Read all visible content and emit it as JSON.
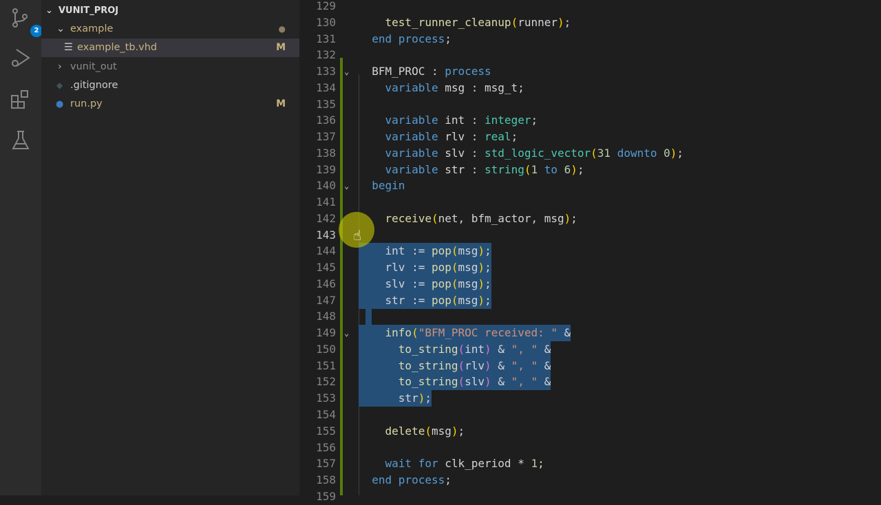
{
  "activity_bar": {
    "source_control_badge": "2",
    "items": [
      "source-control-icon",
      "run-debug-icon",
      "extensions-icon",
      "testing-icon"
    ]
  },
  "explorer": {
    "root": "VUNIT_PROJ",
    "items": [
      {
        "label": "example",
        "type": "folder-open",
        "status": "●",
        "color": "#c9b37e"
      },
      {
        "label": "example_tb.vhd",
        "type": "file",
        "status": "M",
        "color": "#c9b37e"
      },
      {
        "label": "vunit_out",
        "type": "folder-closed",
        "status": "",
        "color": "#8b8b8b"
      },
      {
        "label": ".gitignore",
        "type": "file",
        "status": "",
        "color": "#cccccc"
      },
      {
        "label": "run.py",
        "type": "python",
        "status": "M",
        "color": "#c9b37e"
      }
    ]
  },
  "editor": {
    "first_line": 129,
    "current_line": 143,
    "selection": [
      144,
      153
    ],
    "folds": [
      133,
      140,
      149
    ],
    "lines": [
      [],
      [
        [
          "    "
        ],
        [
          "test_runner_cleanup",
          "f"
        ],
        [
          "(",
          "p1"
        ],
        [
          "runner"
        ],
        [
          ")",
          "p1"
        ],
        [
          ";"
        ]
      ],
      [
        [
          "  "
        ],
        [
          "end process",
          "k"
        ],
        [
          ";"
        ]
      ],
      [],
      [
        [
          "  BFM_PROC : "
        ],
        [
          "process",
          "k"
        ]
      ],
      [
        [
          "    "
        ],
        [
          "variable",
          "k"
        ],
        [
          " msg : msg_t;"
        ]
      ],
      [],
      [
        [
          "    "
        ],
        [
          "variable",
          "k"
        ],
        [
          " int : "
        ],
        [
          "integer",
          "t"
        ],
        [
          ";"
        ]
      ],
      [
        [
          "    "
        ],
        [
          "variable",
          "k"
        ],
        [
          " rlv : "
        ],
        [
          "real",
          "t"
        ],
        [
          ";"
        ]
      ],
      [
        [
          "    "
        ],
        [
          "variable",
          "k"
        ],
        [
          " slv : "
        ],
        [
          "std_logic_vector",
          "t"
        ],
        [
          "(",
          "p1"
        ],
        [
          "31",
          "n"
        ],
        [
          " "
        ],
        [
          "downto",
          "k"
        ],
        [
          " "
        ],
        [
          "0",
          "n"
        ],
        [
          ")",
          "p1"
        ],
        [
          ";"
        ]
      ],
      [
        [
          "    "
        ],
        [
          "variable",
          "k"
        ],
        [
          " str : "
        ],
        [
          "string",
          "t"
        ],
        [
          "(",
          "p1"
        ],
        [
          "1",
          "n"
        ],
        [
          " "
        ],
        [
          "to",
          "k"
        ],
        [
          " "
        ],
        [
          "6",
          "n"
        ],
        [
          ")",
          "p1"
        ],
        [
          ";"
        ]
      ],
      [
        [
          "  "
        ],
        [
          "begin",
          "k"
        ]
      ],
      [],
      [
        [
          "    "
        ],
        [
          "receive",
          "f"
        ],
        [
          "(",
          "p1"
        ],
        [
          "net, bfm_actor, msg"
        ],
        [
          ")",
          "p1"
        ],
        [
          ";"
        ]
      ],
      [],
      [
        [
          "    int := "
        ],
        [
          "pop",
          "f"
        ],
        [
          "(",
          "p1"
        ],
        [
          "msg"
        ],
        [
          ")",
          "p1"
        ],
        [
          ";"
        ]
      ],
      [
        [
          "    rlv := "
        ],
        [
          "pop",
          "f"
        ],
        [
          "(",
          "p1"
        ],
        [
          "msg"
        ],
        [
          ")",
          "p1"
        ],
        [
          ";"
        ]
      ],
      [
        [
          "    slv := "
        ],
        [
          "pop",
          "f"
        ],
        [
          "(",
          "p1"
        ],
        [
          "msg"
        ],
        [
          ")",
          "p1"
        ],
        [
          ";"
        ]
      ],
      [
        [
          "    str := "
        ],
        [
          "pop",
          "f"
        ],
        [
          "(",
          "p1"
        ],
        [
          "msg"
        ],
        [
          ")",
          "p1"
        ],
        [
          ";"
        ]
      ],
      [
        [
          "  "
        ]
      ],
      [
        [
          "    "
        ],
        [
          "info",
          "f"
        ],
        [
          "(",
          "p1"
        ],
        [
          "\"BFM_PROC received: \"",
          "s"
        ],
        [
          " &"
        ]
      ],
      [
        [
          "      "
        ],
        [
          "to_string",
          "f"
        ],
        [
          "(",
          "p2"
        ],
        [
          "int"
        ],
        [
          ")",
          "p2"
        ],
        [
          " & "
        ],
        [
          "\", \"",
          "s"
        ],
        [
          " &"
        ]
      ],
      [
        [
          "      "
        ],
        [
          "to_string",
          "f"
        ],
        [
          "(",
          "p2"
        ],
        [
          "rlv"
        ],
        [
          ")",
          "p2"
        ],
        [
          " & "
        ],
        [
          "\", \"",
          "s"
        ],
        [
          " &"
        ]
      ],
      [
        [
          "      "
        ],
        [
          "to_string",
          "f"
        ],
        [
          "(",
          "p2"
        ],
        [
          "slv"
        ],
        [
          ")",
          "p2"
        ],
        [
          " & "
        ],
        [
          "\", \"",
          "s"
        ],
        [
          " &"
        ]
      ],
      [
        [
          "      str"
        ],
        [
          ")",
          "p1"
        ],
        [
          ";"
        ]
      ],
      [],
      [
        [
          "    "
        ],
        [
          "delete",
          "f"
        ],
        [
          "(",
          "p1"
        ],
        [
          "msg"
        ],
        [
          ")",
          "p1"
        ],
        [
          ";"
        ]
      ],
      [],
      [
        [
          "    "
        ],
        [
          "wait for",
          "k"
        ],
        [
          " clk_period * "
        ],
        [
          "1",
          "n"
        ],
        [
          ";"
        ]
      ],
      [
        [
          "  "
        ],
        [
          "end process",
          "k"
        ],
        [
          ";"
        ]
      ],
      []
    ]
  }
}
